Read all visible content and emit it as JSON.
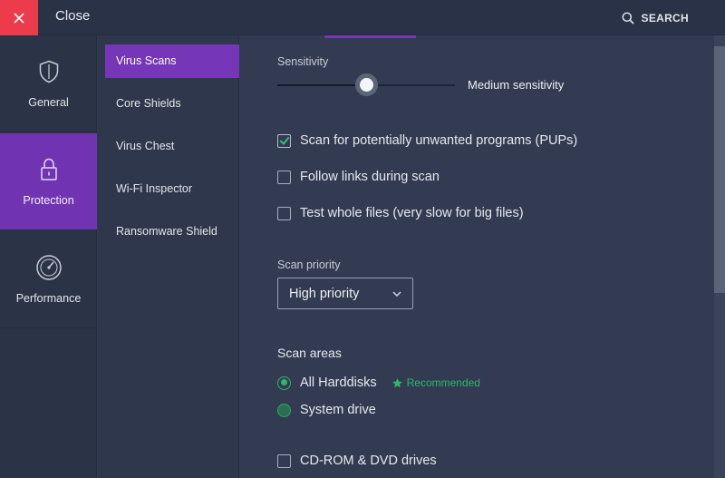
{
  "topbar": {
    "close_label": "Close",
    "search_label": "SEARCH"
  },
  "leftnav": {
    "items": [
      {
        "label": "General",
        "icon": "shield-icon",
        "active": false
      },
      {
        "label": "Protection",
        "icon": "lock-icon",
        "active": true
      },
      {
        "label": "Performance",
        "icon": "speedometer-icon",
        "active": false
      }
    ]
  },
  "subnav": {
    "items": [
      {
        "label": "Virus Scans",
        "active": true
      },
      {
        "label": "Core Shields",
        "active": false
      },
      {
        "label": "Virus Chest",
        "active": false
      },
      {
        "label": "Wi-Fi Inspector",
        "active": false
      },
      {
        "label": "Ransomware Shield",
        "active": false
      }
    ]
  },
  "main": {
    "sensitivity": {
      "label": "Sensitivity",
      "value_label": "Medium sensitivity",
      "level": 0.5
    },
    "options": [
      {
        "label": "Scan for potentially unwanted programs (PUPs)",
        "checked": true
      },
      {
        "label": "Follow links during scan",
        "checked": false
      },
      {
        "label": "Test whole files (very slow for big files)",
        "checked": false
      }
    ],
    "scan_priority": {
      "label": "Scan priority",
      "selected": "High priority"
    },
    "scan_areas": {
      "title": "Scan areas",
      "options": [
        {
          "label": "All Harddisks",
          "checked": true,
          "badge": "Recommended"
        },
        {
          "label": "System drive",
          "checked": false
        }
      ],
      "extra": {
        "label": "CD-ROM & DVD drives",
        "checked": false
      }
    }
  },
  "colors": {
    "accent_purple": "#7536b8",
    "close_red": "#ec3b4c",
    "success_green": "#2fb868",
    "background": "#323b52"
  }
}
